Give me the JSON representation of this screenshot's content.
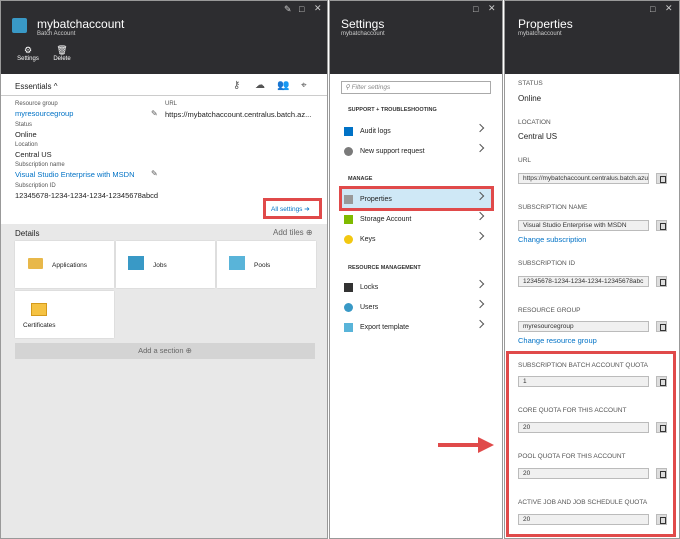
{
  "batch": {
    "title": "mybatchaccount",
    "subtitle": "Batch Account",
    "settings_label": "Settings",
    "delete_label": "Delete",
    "essentials_label": "Essentials",
    "rg_label": "Resource group",
    "rg_value": "myresourcegroup",
    "status_label": "Status",
    "status_value": "Online",
    "location_label": "Location",
    "location_value": "Central US",
    "sub_label": "Subscription name",
    "sub_value": "Visual Studio Enterprise with MSDN",
    "subid_label": "Subscription ID",
    "subid_value": "12345678-1234-1234-1234-12345678abcd",
    "url_label": "URL",
    "url_value": "https://mybatchaccount.centralus.batch.az...",
    "all_settings": "All settings",
    "details_label": "Details",
    "add_tiles": "Add tiles",
    "tiles": [
      "Applications",
      "Jobs",
      "Pools",
      "Certificates"
    ],
    "add_section": "Add a section"
  },
  "settings": {
    "title": "Settings",
    "subtitle": "mybatchaccount",
    "filter_placeholder": "Filter settings",
    "sec1": "SUPPORT + TROUBLESHOOTING",
    "audit": "Audit logs",
    "support": "New support request",
    "sec2": "MANAGE",
    "properties": "Properties",
    "storage": "Storage Account",
    "keys": "Keys",
    "sec3": "RESOURCE MANAGEMENT",
    "locks": "Locks",
    "users": "Users",
    "export": "Export template"
  },
  "props": {
    "title": "Properties",
    "subtitle": "mybatchaccount",
    "status_label": "STATUS",
    "status_value": "Online",
    "location_label": "LOCATION",
    "location_value": "Central US",
    "url_label": "URL",
    "url_value": "https://mybatchaccount.centralus.batch.azure",
    "subname_label": "SUBSCRIPTION NAME",
    "subname_value": "Visual Studio Enterprise with MSDN",
    "change_sub": "Change subscription",
    "subid_label": "SUBSCRIPTION ID",
    "subid_value": "12345678-1234-1234-1234-12345678abc",
    "rg_label": "RESOURCE GROUP",
    "rg_value": "myresourcegroup",
    "change_rg": "Change resource group",
    "q1_label": "SUBSCRIPTION BATCH ACCOUNT QUOTA",
    "q1_value": "1",
    "q2_label": "CORE QUOTA FOR THIS ACCOUNT",
    "q2_value": "20",
    "q3_label": "POOL QUOTA FOR THIS ACCOUNT",
    "q3_value": "20",
    "q4_label": "ACTIVE JOB AND JOB SCHEDULE QUOTA",
    "q4_value": "20"
  },
  "colors": {
    "header": "#2d2d30",
    "link": "#0072c6",
    "highlight": "#e04a4a",
    "selected": "#cfe8f6"
  }
}
